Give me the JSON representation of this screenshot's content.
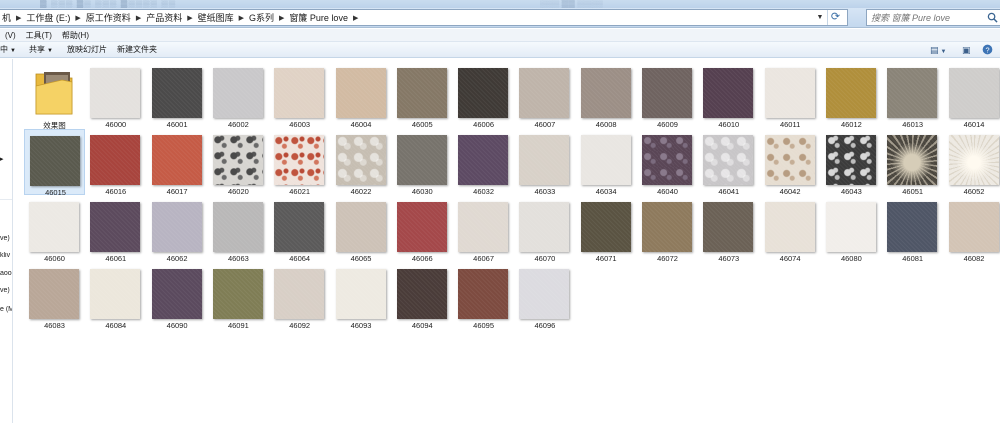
{
  "window": {
    "title_fragment": "",
    "search_placeholder": "搜索 窗簾 Pure love"
  },
  "address": {
    "crumbs": [
      "机",
      "工作盘 (E:)",
      "原工作资料",
      "产品资料",
      "壁纸图库",
      "G系列",
      "窗簾 Pure love"
    ]
  },
  "menu": {
    "items": [
      "(V)",
      "工具(T)",
      "帮助(H)"
    ]
  },
  "toolbar": {
    "organize": "中",
    "share": "共享",
    "slideshow": "放映幻灯片",
    "new_folder": "新建文件夹"
  },
  "nav": {
    "items": [
      "ve)",
      "kliv",
      "aoo",
      "ve)",
      "e (M"
    ]
  },
  "files": [
    {
      "name": "效果图",
      "type": "folder"
    },
    {
      "name": "46000",
      "color": "#e4e1de"
    },
    {
      "name": "46001",
      "color": "#4b4a4a"
    },
    {
      "name": "46002",
      "color": "#c9c8ca"
    },
    {
      "name": "46003",
      "color": "#e0d2c5"
    },
    {
      "name": "46004",
      "color": "#d2bba3"
    },
    {
      "name": "46005",
      "color": "#857866"
    },
    {
      "name": "46006",
      "color": "#3f3a36"
    },
    {
      "name": "46007",
      "color": "#bfb4aa"
    },
    {
      "name": "46008",
      "color": "#9c8f86"
    },
    {
      "name": "46009",
      "color": "#6f6360"
    },
    {
      "name": "46010",
      "color": "#554050"
    },
    {
      "name": "46011",
      "color": "#ebe6e0"
    },
    {
      "name": "46012",
      "color": "#b08f3b"
    },
    {
      "name": "46013",
      "color": "#8a8478"
    },
    {
      "name": "46014",
      "color": "#cfcdcb"
    },
    {
      "name": "46015",
      "color": "#5a5a4e",
      "selected": true
    },
    {
      "name": "46016",
      "color": "#a8443d"
    },
    {
      "name": "46017",
      "color": "#c55b46"
    },
    {
      "name": "46020",
      "color": "#d7d5d1",
      "pattern": "floral-grey"
    },
    {
      "name": "46021",
      "color": "#efe3dc",
      "pattern": "floral-red"
    },
    {
      "name": "46022",
      "color": "#c6beb2",
      "pattern": "floral-soft"
    },
    {
      "name": "46030",
      "color": "#77736c"
    },
    {
      "name": "46032",
      "color": "#5d4a63"
    },
    {
      "name": "46033",
      "color": "#d8d1c8"
    },
    {
      "name": "46034",
      "color": "#e9e6e2"
    },
    {
      "name": "46040",
      "color": "#5a4656",
      "pattern": "floral-dark"
    },
    {
      "name": "46041",
      "color": "#c8c6c8",
      "pattern": "floral-soft"
    },
    {
      "name": "46042",
      "color": "#e6ddd1",
      "pattern": "floral-beige"
    },
    {
      "name": "46043",
      "color": "#3b3b3b",
      "pattern": "floral-black"
    },
    {
      "name": "46051",
      "color": "#4a463e",
      "pattern": "burst"
    },
    {
      "name": "46052",
      "color": "#ede9e2",
      "pattern": "burst-light"
    },
    {
      "name": "46060",
      "color": "#ece9e4"
    },
    {
      "name": "46061",
      "color": "#5c4a5d"
    },
    {
      "name": "46062",
      "color": "#b8b4c2"
    },
    {
      "name": "46063",
      "color": "#b9b8b8"
    },
    {
      "name": "46064",
      "color": "#5b5a5a"
    },
    {
      "name": "46065",
      "color": "#cdc2b7"
    },
    {
      "name": "46066",
      "color": "#a4484a"
    },
    {
      "name": "46067",
      "color": "#e0d9d2"
    },
    {
      "name": "46070",
      "color": "#e3e0dc"
    },
    {
      "name": "46071",
      "color": "#5a5342"
    },
    {
      "name": "46072",
      "color": "#8e7a5d"
    },
    {
      "name": "46073",
      "color": "#6b6156"
    },
    {
      "name": "46074",
      "color": "#e8e1d8"
    },
    {
      "name": "46080",
      "color": "#f1eeea"
    },
    {
      "name": "46081",
      "color": "#4f5666"
    },
    {
      "name": "46082",
      "color": "#d3c4b5"
    },
    {
      "name": "46083",
      "color": "#b9a798"
    },
    {
      "name": "46084",
      "color": "#ece7dc"
    },
    {
      "name": "46090",
      "color": "#5b4a5e"
    },
    {
      "name": "46091",
      "color": "#7f7d55"
    },
    {
      "name": "46092",
      "color": "#d8cfc6"
    },
    {
      "name": "46093",
      "color": "#eeeae2"
    },
    {
      "name": "46094",
      "color": "#4a3c39"
    },
    {
      "name": "46095",
      "color": "#7d4b40"
    },
    {
      "name": "46096",
      "color": "#dcdbe0"
    }
  ],
  "icons": {
    "search": "search-icon",
    "refresh": "refresh-icon",
    "folder": "folder-icon",
    "view": "view-icon",
    "preview_pane": "preview-pane-icon",
    "help": "help-icon"
  }
}
